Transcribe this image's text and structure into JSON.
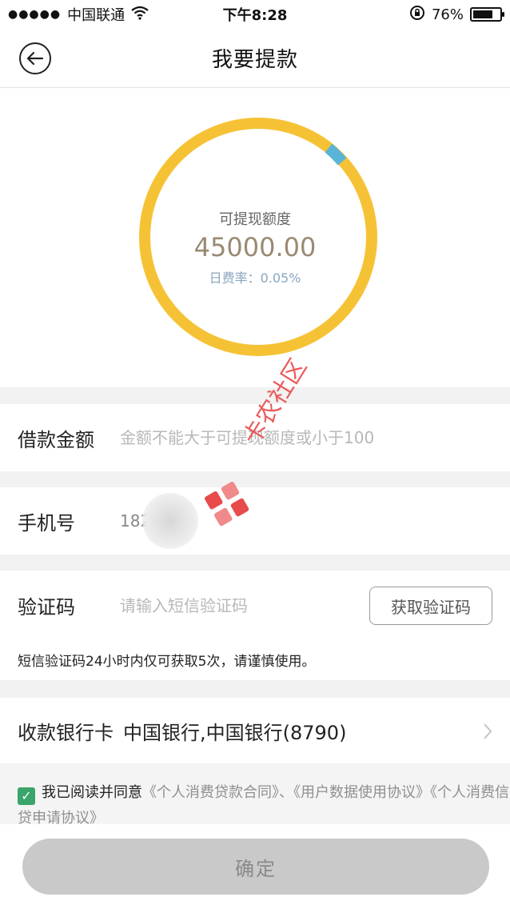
{
  "status_bar": {
    "signal_dots": "●●●●●",
    "carrier": "中国联通",
    "time": "下午8:28",
    "battery_percent": "76%",
    "battery_level": 0.76,
    "icons": [
      "signal-icon",
      "wifi-icon",
      "rotation-lock-icon",
      "battery-icon"
    ]
  },
  "nav": {
    "title": "我要提款",
    "back_icon": "back-arrow-icon"
  },
  "credit": {
    "label": "可提现额度",
    "amount": "45000.00",
    "rate": "日费率：0.05%",
    "ring_color": "#f6c235",
    "ring_accent_color": "#5ab4d8"
  },
  "form": {
    "loan_amount": {
      "label": "借款金额",
      "placeholder": "金额不能大于可提现额度或小于100"
    },
    "phone": {
      "label": "手机号",
      "value": "182"
    },
    "sms_code": {
      "label": "验证码",
      "placeholder": "请输入短信验证码",
      "button": "获取验证码"
    },
    "sms_note": "短信验证码24小时内仅可获取5次，请谨慎使用。",
    "bank": {
      "label": "收款银行卡",
      "name": "中国银行,中国银行(8790)"
    }
  },
  "agreement": {
    "checkbox_checked": true,
    "checkbox_mark": "✓",
    "text": "我已阅读并同意",
    "link1": "《个人消费贷款合同》",
    "separator": "、",
    "link2": "《用户数据使用协议》",
    "link3": "《个人消费信贷申请协议》"
  },
  "confirm_button": "确定",
  "watermark": {
    "text": "卡农社区",
    "logo_icon": "kanong-logo-icon"
  }
}
